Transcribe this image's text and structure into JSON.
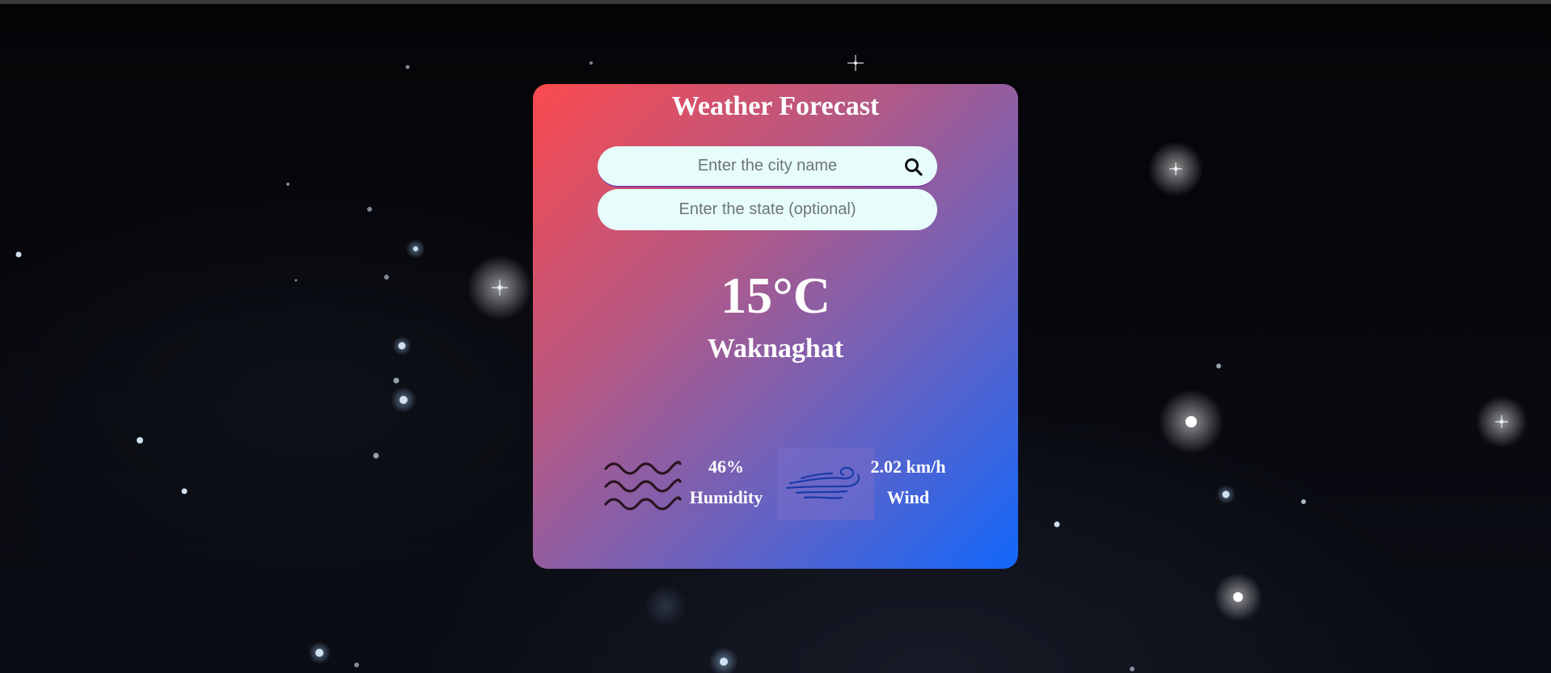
{
  "app": {
    "title": "Weather Forecast"
  },
  "search": {
    "city_placeholder": "Enter the city name",
    "state_placeholder": "Enter the state (optional)",
    "city_value": "",
    "state_value": ""
  },
  "weather": {
    "temperature": "15°C",
    "city": "Waknaghat",
    "humidity_value": "46%",
    "humidity_label": "Humidity",
    "wind_value": "2.02 km/h",
    "wind_label": "Wind"
  },
  "icons": {
    "search": "search-icon",
    "humidity": "waves-icon",
    "wind": "wind-icon"
  },
  "colors": {
    "card_gradient_start": "#fa4a4e",
    "card_gradient_end": "#1267fb",
    "input_background": "#e6fdfb",
    "text": "#ffffff"
  }
}
